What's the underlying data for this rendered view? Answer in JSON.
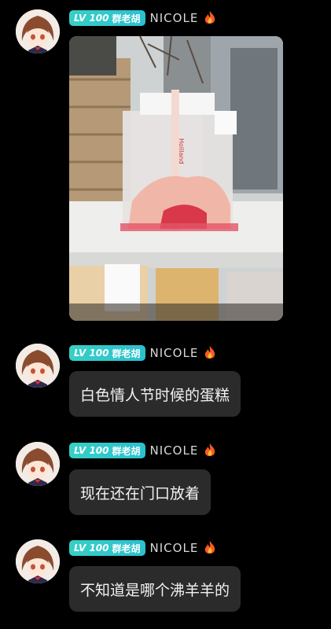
{
  "messages": [
    {
      "badge_level": "LV 100",
      "badge_group": "群老胡",
      "nickname": "NICOLE",
      "type": "image",
      "image": {
        "box_label": "Holiland",
        "icon": "cake-photo"
      }
    },
    {
      "badge_level": "LV 100",
      "badge_group": "群老胡",
      "nickname": "NICOLE",
      "type": "text",
      "text": "白色情人节时候的蛋糕"
    },
    {
      "badge_level": "LV 100",
      "badge_group": "群老胡",
      "nickname": "NICOLE",
      "type": "text",
      "text": "现在还在门口放着"
    },
    {
      "badge_level": "LV 100",
      "badge_group": "群老胡",
      "nickname": "NICOLE",
      "type": "text",
      "text": "不知道是哪个沸羊羊的"
    }
  ],
  "colors": {
    "background": "#000000",
    "bubble": "#2b2b2b",
    "badge": "#36d0c6",
    "fire": "#ff5a1f"
  }
}
